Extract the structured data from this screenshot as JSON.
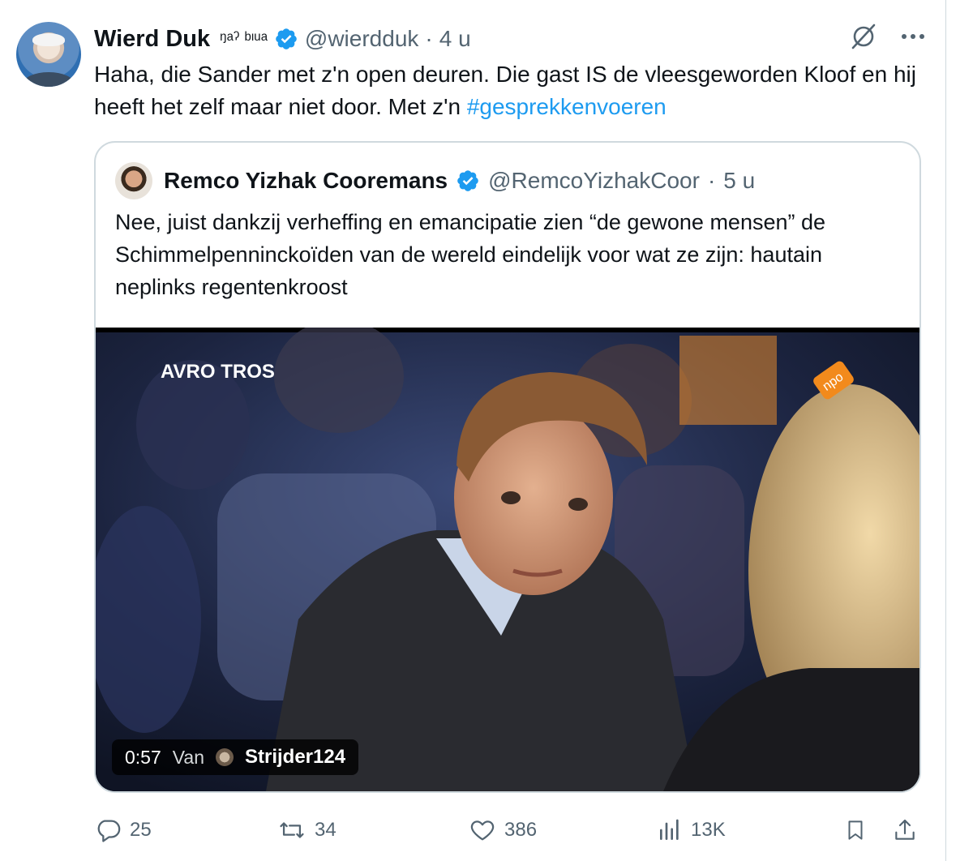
{
  "tweet": {
    "author": {
      "name": "Wierd Duk",
      "name_decoration": "ᵑᵃˀ ᵇᶦᵘᵃ",
      "handle": "@wierdduk",
      "time": "4 u"
    },
    "text": "Haha, die Sander met z'n open deuren. Die gast IS de vleesgeworden Kloof en hij heeft het zelf maar niet door. Met z'n ",
    "hashtag": "#gesprekkenvoeren",
    "separator": "·"
  },
  "quote": {
    "author": {
      "name": "Remco Yizhak Cooremans",
      "handle": "@RemcoYizhakCoor",
      "time": "5 u"
    },
    "text": "Nee, juist dankzij verheffing en emancipatie zien “de gewone mensen” de Schimmelpenninckoïden van de wereld eindelijk voor wat ze zijn: hautain neplinks regentenkroost",
    "video": {
      "duration": "0:57",
      "via_label": "Van",
      "via_user": "Strijder124",
      "logo_left": "AVRO TROS",
      "logo_right": "npo"
    }
  },
  "actions": {
    "replies": "25",
    "retweets": "34",
    "likes": "386",
    "views": "13K"
  },
  "colors": {
    "accent": "#1d9bf0",
    "secondary_text": "#536471",
    "border": "#cfd9de"
  },
  "icons": [
    "verified-badge-icon",
    "grok-icon",
    "more-icon",
    "reply-icon",
    "retweet-icon",
    "like-icon",
    "views-icon",
    "bookmark-icon",
    "share-icon"
  ]
}
